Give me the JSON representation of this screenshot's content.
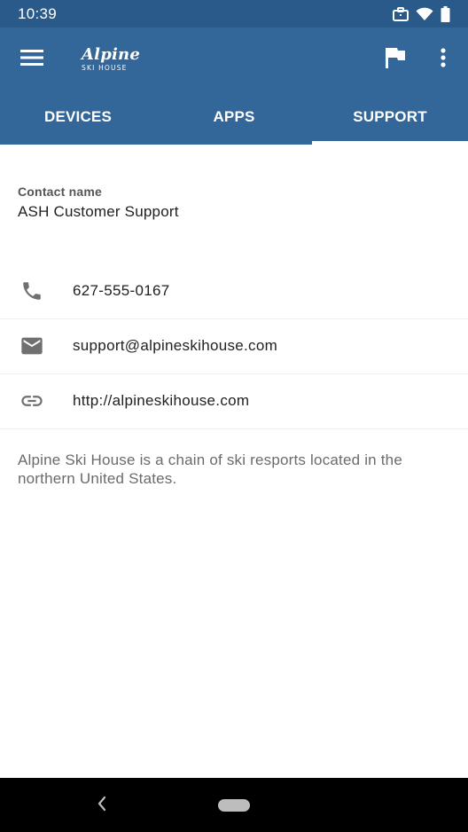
{
  "status_bar": {
    "time": "10:39",
    "icons": [
      "briefcase-icon",
      "wifi-icon",
      "battery-icon"
    ]
  },
  "app_bar": {
    "logo_main": "Alpine",
    "logo_sub": "SKI HOUSE",
    "icons": [
      "menu-icon",
      "flag-icon",
      "more-vert-icon"
    ]
  },
  "tabs": [
    {
      "label": "DEVICES",
      "active": false
    },
    {
      "label": "APPS",
      "active": false
    },
    {
      "label": "SUPPORT",
      "active": true
    }
  ],
  "support": {
    "contact_label": "Contact name",
    "contact_value": "ASH Customer Support",
    "rows": [
      {
        "icon": "phone-icon",
        "text": "627-555-0167"
      },
      {
        "icon": "email-icon",
        "text": "support@alpineskihouse.com"
      },
      {
        "icon": "link-icon",
        "text": "http://alpineskihouse.com"
      }
    ],
    "description": "Alpine Ski House is a chain of ski resports located in the northern United States."
  },
  "nav_bar": {
    "icons": [
      "back-icon",
      "home-pill-icon"
    ]
  },
  "colors": {
    "app_bar": "#336699",
    "status_bar": "#2a5a8a",
    "tab_indicator": "#ffffff",
    "icon_gray": "#707070"
  }
}
